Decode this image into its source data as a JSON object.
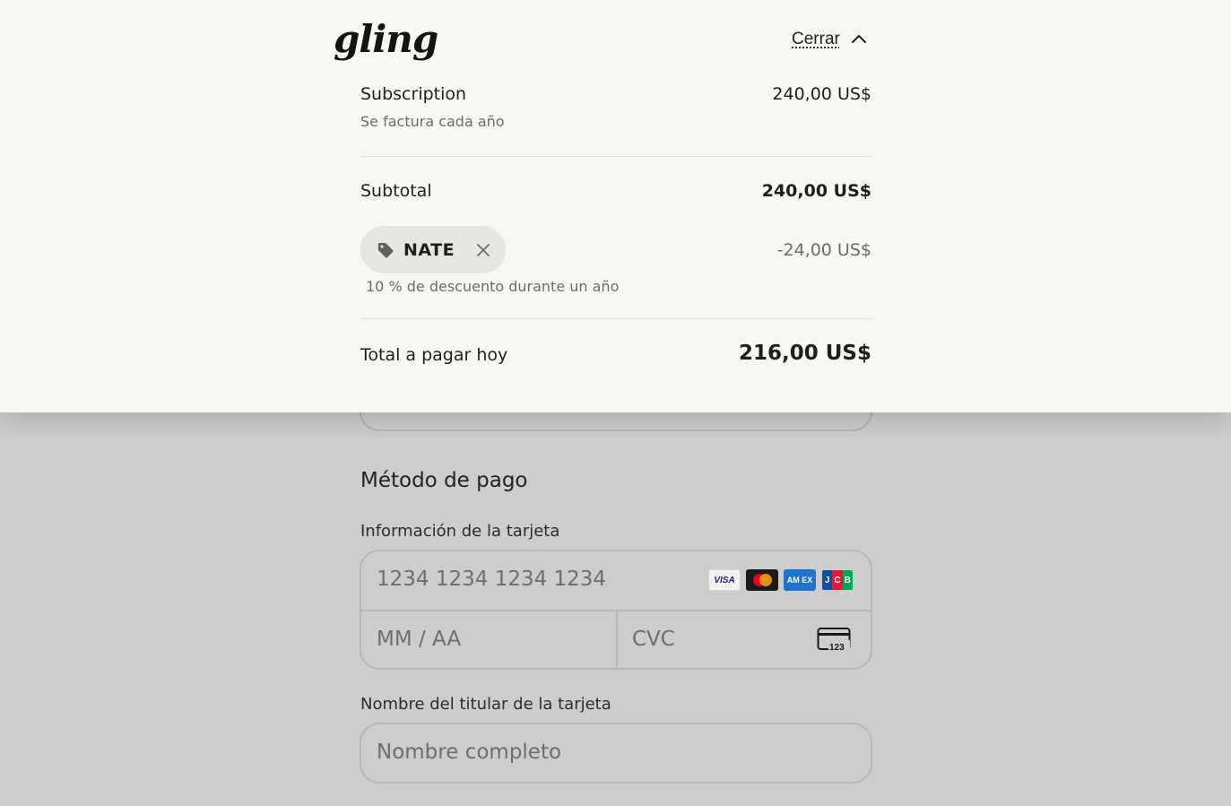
{
  "header": {
    "logo_text": "gling",
    "close_label": "Cerrar",
    "close_icon": "chevron-up-icon"
  },
  "summary": {
    "subscription": {
      "title": "Subscription",
      "subtitle": "Se factura cada año",
      "amount": "240,00 US$"
    },
    "subtotal": {
      "label": "Subtotal",
      "amount": "240,00 US$"
    },
    "promo": {
      "icon": "tag-icon",
      "code": "NATE",
      "remove_icon": "close-icon",
      "description": "10 % de descuento durante un año",
      "amount": "-24,00 US$"
    },
    "total": {
      "label": "Total a pagar hoy",
      "amount": "216,00 US$"
    }
  },
  "payment": {
    "section_title": "Método de pago",
    "card_label": "Información de la tarjeta",
    "card_number_placeholder": "1234 1234 1234 1234",
    "expiry_placeholder": "MM / AA",
    "cvc_placeholder": "CVC",
    "brands": {
      "visa": "VISA",
      "amex": "AM EX",
      "jcb": [
        "J",
        "C",
        "B"
      ]
    },
    "cvc_icon_text": "123",
    "holder_label": "Nombre del titular de la tarjeta",
    "holder_placeholder": "Nombre completo"
  },
  "colors": {
    "panel_bg": "#f8f8f3",
    "overlay_bg": "#cdcdcd",
    "chip_bg": "#e6e6e1",
    "muted_text": "#6b6b6b"
  }
}
